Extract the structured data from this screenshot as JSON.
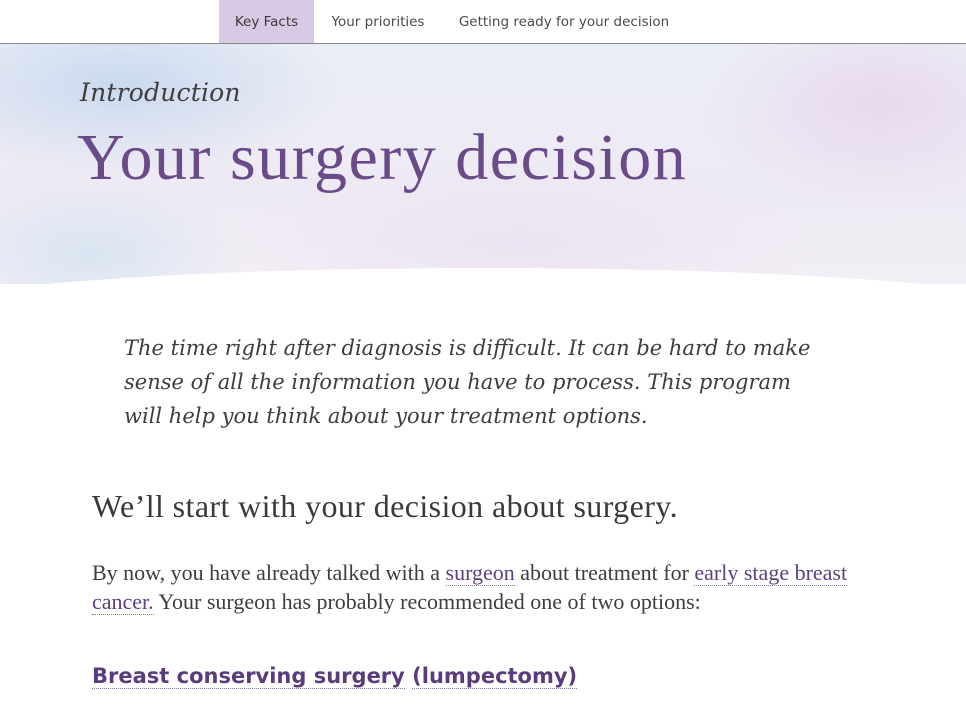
{
  "nav": {
    "tabs": [
      {
        "label": "Key Facts",
        "active": true
      },
      {
        "label": "Your priorities",
        "active": false
      },
      {
        "label": "Getting ready for your decision",
        "active": false
      }
    ]
  },
  "header": {
    "kicker": "Introduction",
    "title": "Your surgery decision"
  },
  "content": {
    "intro_quote": "The time right after diagnosis is difficult. It can be hard to make sense of all the information you have to process. This program will help you think about your treatment options.",
    "section_heading": "We’ll start with your decision about surgery.",
    "para": {
      "part1": "By now, you have already talked with a ",
      "link_surgeon": "surgeon",
      "part2": " about treatment for ",
      "link_early_stage": "early stage breast cancer.",
      "part3": " Your surgeon has probably recommended one of two options:"
    },
    "option1": {
      "link_label": "Breast conserving surgery",
      "paren_label": "(lumpectomy)"
    }
  },
  "colors": {
    "accent": "#6b4a8a",
    "active_tab": "#d8c9e4",
    "link": "#5e3f80"
  }
}
